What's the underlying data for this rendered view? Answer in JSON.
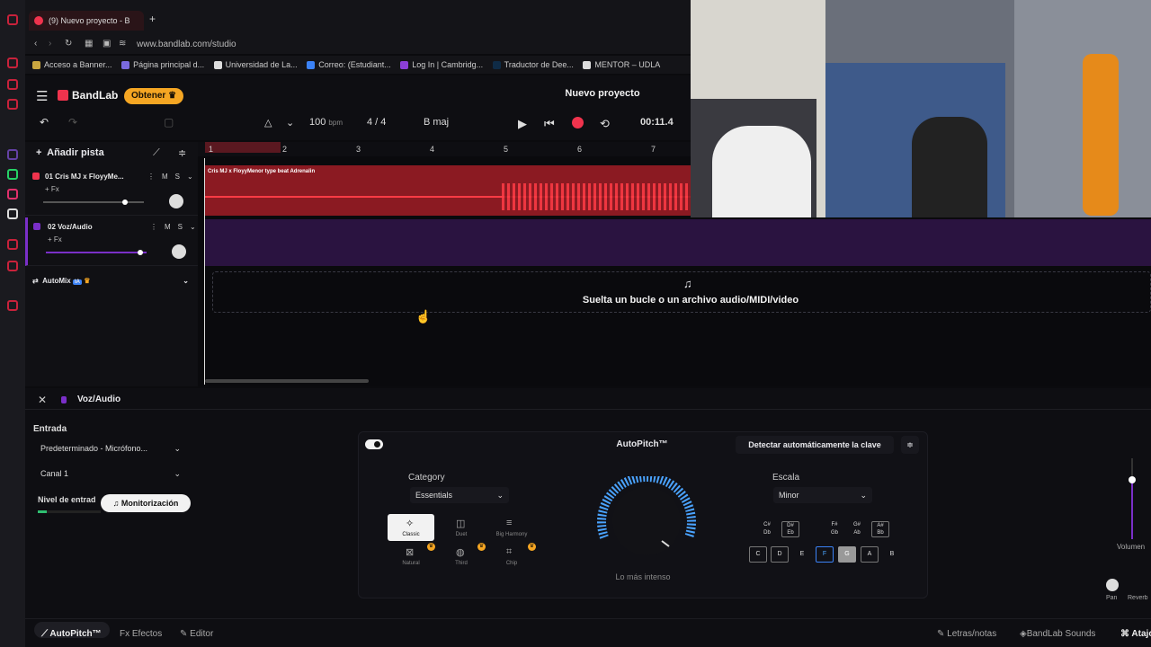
{
  "browser": {
    "tab_title": "(9) Nuevo proyecto - B",
    "url": "www.bandlab.com/studio",
    "bookmarks": [
      "Acceso a Banner...",
      "Página principal d...",
      "Universidad de La...",
      "Correo: (Estudiant...",
      "Log In | Cambridg...",
      "Traductor de Dee...",
      "MENTOR – UDLA"
    ]
  },
  "app": {
    "logo": "BandLab",
    "upgrade_label": "Obtener",
    "project_title": "Nuevo proyecto",
    "transport": {
      "bpm": "100",
      "bpm_unit": "bpm",
      "time_sig": "4 / 4",
      "key": "B maj",
      "time": "00:11.4"
    },
    "add_track_label": "Añadir pista"
  },
  "ruler_ticks": [
    "1",
    "2",
    "3",
    "4",
    "5",
    "6",
    "7"
  ],
  "tracks": [
    {
      "label": "01  Cris MJ x FloyyMe...",
      "fx": "+ Fx",
      "m": "M",
      "s": "S",
      "clip_title": "Cris MJ x FloyyMenor type beat Adrenalin"
    },
    {
      "label": "02  Voz/Audio",
      "fx": "+ Fx",
      "m": "M",
      "s": "S"
    }
  ],
  "automix": {
    "label": "AutoMix",
    "badge": "IA"
  },
  "drop_text": "Suelta un bucle o un archivo audio/MIDI/video",
  "panel": {
    "track_name": "Voz/Audio",
    "input_label": "Entrada",
    "input_device": "Predeterminado - Micrófono...",
    "channel": "Canal 1",
    "level_label": "Nivel de entrad",
    "monitor_label": "Monitorización"
  },
  "autopitch": {
    "title": "AutoPitch™",
    "detect_label": "Detectar automáticamente la clave",
    "category_label": "Category",
    "category_value": "Essentials",
    "presets": [
      "Classic",
      "Duet",
      "Big Harmony",
      "Natural",
      "Third",
      "Chip"
    ],
    "dial_caption": "Lo más intenso",
    "scale_label": "Escala",
    "scale_value": "Minor",
    "sharps": [
      "C#\nDb",
      "D#\nEb",
      "F#\nGb",
      "G#\nAb",
      "A#\nBb"
    ],
    "notes": [
      "C",
      "D",
      "E",
      "F",
      "G",
      "A",
      "B"
    ]
  },
  "right_mixer": {
    "volume_label": "Volumen",
    "pan_label": "Pan",
    "reverb_label": "Reverb"
  },
  "bottom_tabs": {
    "autopitch": "AutoPitch™",
    "effects": "Efectos",
    "editor": "Editor",
    "lyrics": "Letras/notas",
    "sounds": "BandLab Sounds",
    "shortcuts": "Atajos"
  },
  "colors": {
    "brand": "#f0334d",
    "accent": "#f5a623",
    "track1": "#8b1a22",
    "track2": "#2a1340",
    "dial": "#4aa3ff"
  }
}
